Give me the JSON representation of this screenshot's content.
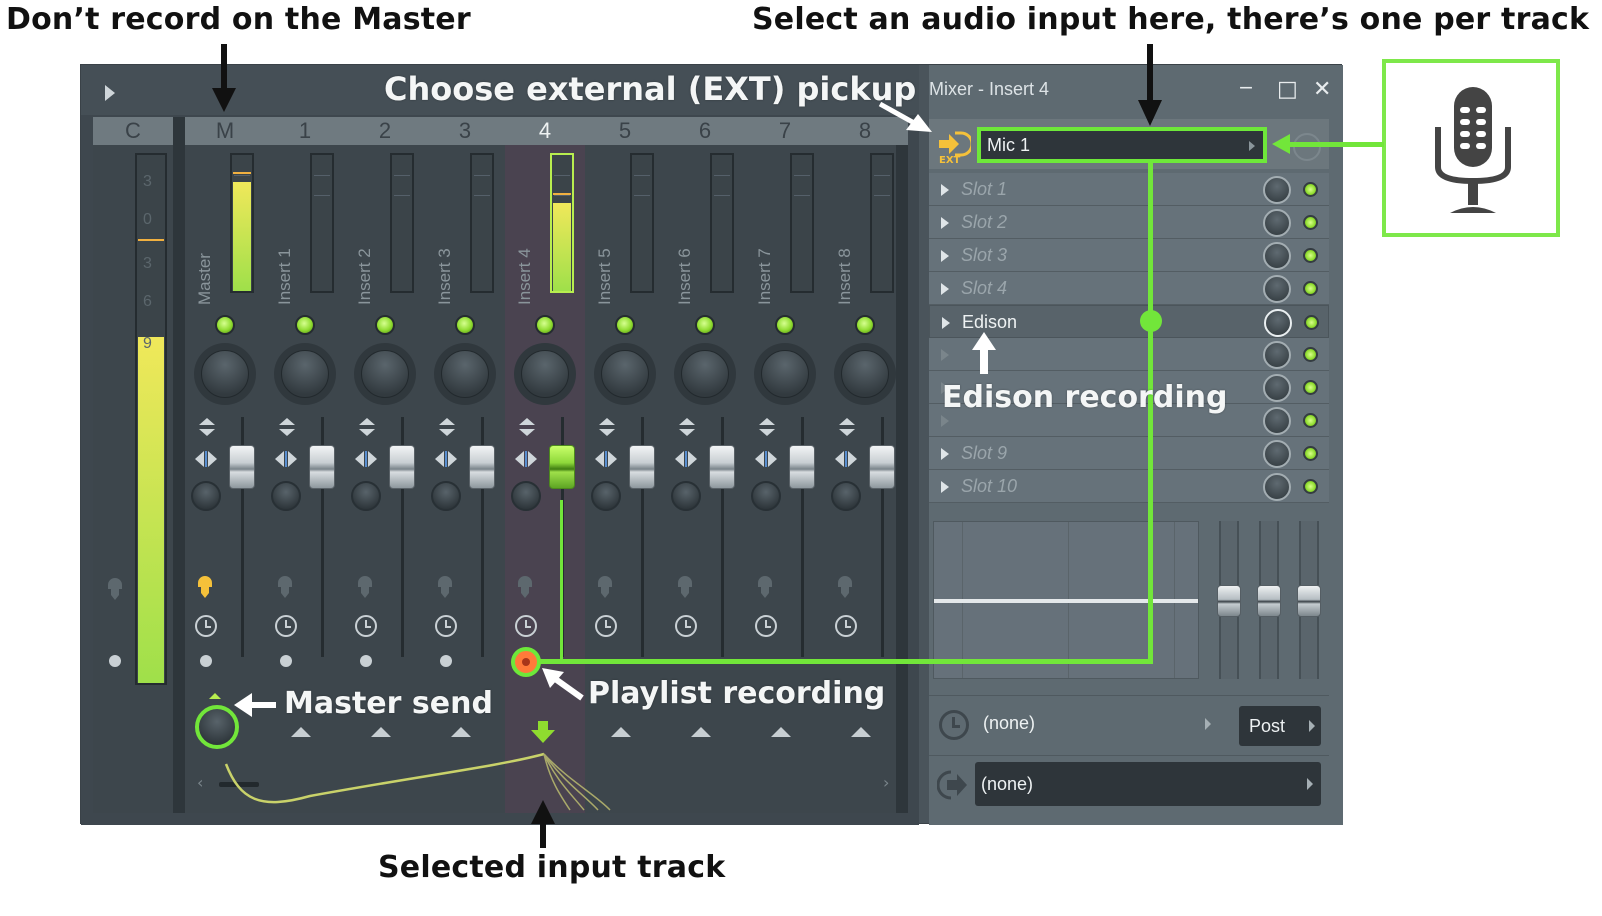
{
  "annotations": {
    "dont_record_master": "Don’t record on the Master",
    "select_audio_input": "Select an audio input here, there’s one per track",
    "choose_external": "Choose external (EXT) pickup",
    "edison_recording": "Edison recording",
    "master_send": "Master send",
    "playlist_recording": "Playlist recording",
    "selected_input_track": "Selected input track"
  },
  "mixer": {
    "title": "Mixer - Insert 4",
    "window_controls": {
      "minimize": "‒",
      "maximize": "□",
      "close": "✕"
    },
    "header_cells": [
      "C",
      "M",
      "1",
      "2",
      "3",
      "4",
      "5",
      "6",
      "7",
      "8"
    ],
    "selected_track": "4",
    "current_meter_scale": [
      "3",
      "0",
      "3",
      "6",
      "9"
    ],
    "tracks": [
      {
        "num": "M",
        "name": "Master",
        "level_l": 0.8,
        "level_r": 0.8,
        "armed_input": true
      },
      {
        "num": "1",
        "name": "Insert 1",
        "level_l": 0,
        "level_r": 0
      },
      {
        "num": "2",
        "name": "Insert 2",
        "level_l": 0,
        "level_r": 0
      },
      {
        "num": "3",
        "name": "Insert 3",
        "level_l": 0,
        "level_r": 0
      },
      {
        "num": "4",
        "name": "Insert 4",
        "level_l": 0.65,
        "level_r": 0.65,
        "selected": true,
        "record_armed": true
      },
      {
        "num": "5",
        "name": "Insert 5",
        "level_l": 0,
        "level_r": 0
      },
      {
        "num": "6",
        "name": "Insert 6",
        "level_l": 0,
        "level_r": 0
      },
      {
        "num": "7",
        "name": "Insert 7",
        "level_l": 0,
        "level_r": 0
      },
      {
        "num": "8",
        "name": "Insert 8",
        "level_l": 0,
        "level_r": 0
      }
    ],
    "input": {
      "ext_label": "EXT",
      "value": "Mic 1"
    },
    "slots": [
      {
        "name": "Slot 1",
        "active": false
      },
      {
        "name": "Slot 2",
        "active": false
      },
      {
        "name": "Slot 3",
        "active": false
      },
      {
        "name": "Slot 4",
        "active": false
      },
      {
        "name": "Edison",
        "active": true
      },
      {
        "name": "",
        "active": false
      },
      {
        "name": "",
        "active": false
      },
      {
        "name": "",
        "active": false
      },
      {
        "name": "Slot 9",
        "active": false
      },
      {
        "name": "Slot 10",
        "active": false
      }
    ],
    "time_offset": {
      "value": "(none)",
      "mode": "Post"
    },
    "output": {
      "value": "(none)"
    }
  },
  "colors": {
    "highlight_green": "#72e63a",
    "meter_green": "#9fe04a",
    "record_orange": "#ff7a3a",
    "selected_strip": "#4a4350",
    "ext_yellow": "#f5c13a"
  }
}
